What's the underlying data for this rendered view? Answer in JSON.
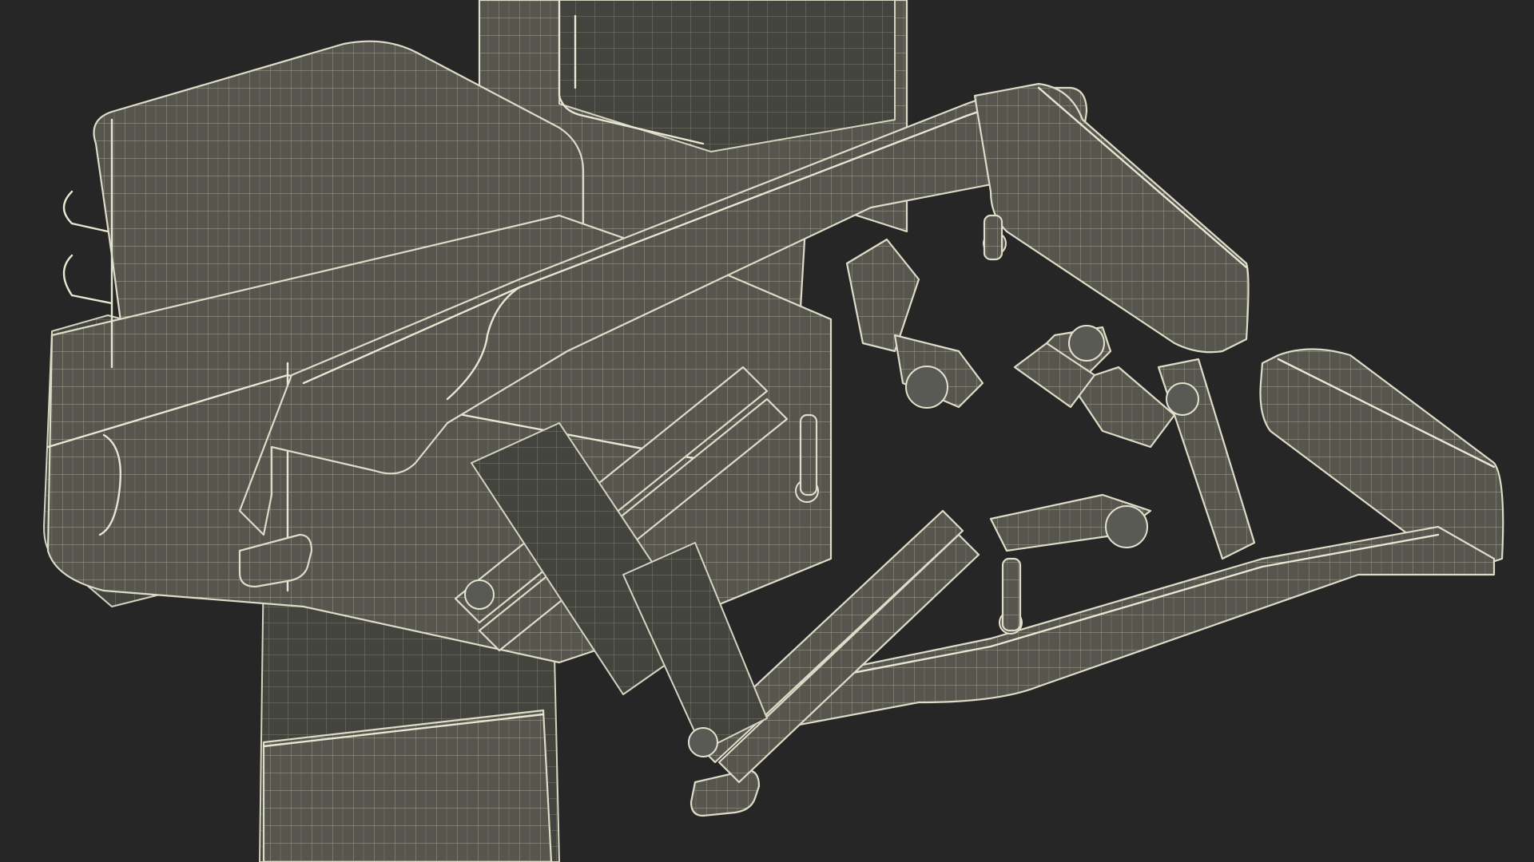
{
  "colors": {
    "background": "#262626",
    "body": "#545450",
    "body_shadow": "#3e3e3b",
    "wire": "#d8d8c4"
  }
}
